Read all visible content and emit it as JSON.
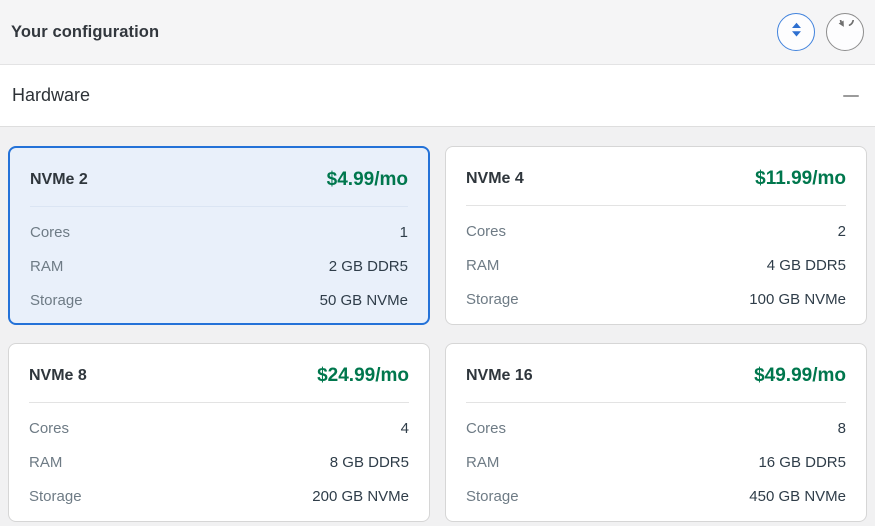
{
  "header": {
    "title": "Your configuration",
    "toggle_button": "collapse-expand-all",
    "reset_button": "reset-configuration"
  },
  "section": {
    "title": "Hardware",
    "collapsed": false
  },
  "spec_labels": {
    "cores": "Cores",
    "ram": "RAM",
    "storage": "Storage"
  },
  "plans": [
    {
      "name": "NVMe 2",
      "price": "$4.99/mo",
      "cores": "1",
      "ram": "2 GB DDR5",
      "storage": "50 GB NVMe",
      "selected": true
    },
    {
      "name": "NVMe 4",
      "price": "$11.99/mo",
      "cores": "2",
      "ram": "4 GB DDR5",
      "storage": "100 GB NVMe",
      "selected": false
    },
    {
      "name": "NVMe 8",
      "price": "$24.99/mo",
      "cores": "4",
      "ram": "8 GB DDR5",
      "storage": "200 GB NVMe",
      "selected": false
    },
    {
      "name": "NVMe 16",
      "price": "$49.99/mo",
      "cores": "8",
      "ram": "16 GB DDR5",
      "storage": "450 GB NVMe",
      "selected": false
    }
  ],
  "colors": {
    "price_green": "#00774d",
    "selected_border_blue": "#2472d8",
    "selected_bg_blue": "#e9f0fa",
    "header_bg": "#f5f5f6",
    "cards_area_bg": "#f1f1f2",
    "icon_blue": "#2e6fd0",
    "icon_gray": "#6f6f6f"
  }
}
